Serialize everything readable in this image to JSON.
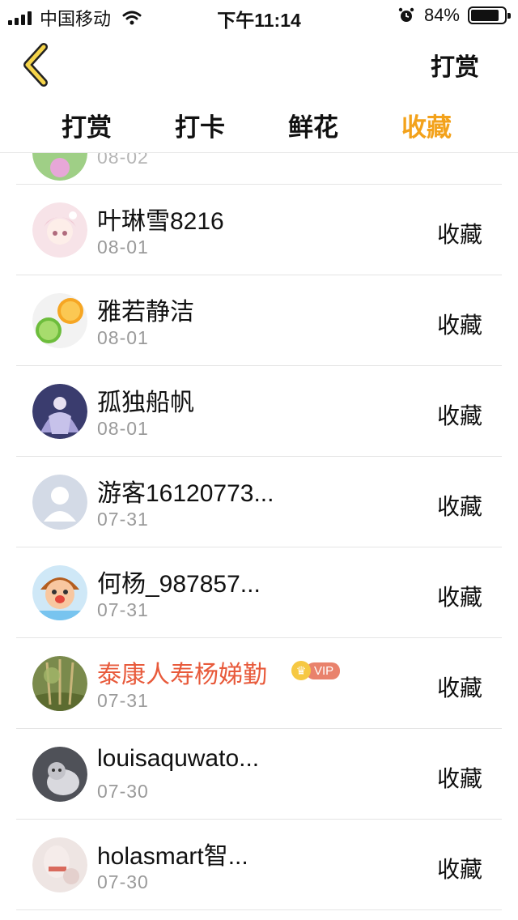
{
  "status_bar": {
    "carrier": "中国移动",
    "time": "下午11:14",
    "battery": "84%",
    "battery_level": 0.84
  },
  "nav": {
    "back_icon": "chevron-left-icon",
    "right_action": "打赏"
  },
  "tabs": [
    {
      "label": "打赏",
      "active": false
    },
    {
      "label": "打卡",
      "active": false
    },
    {
      "label": "鲜花",
      "active": false
    },
    {
      "label": "收藏",
      "active": true
    }
  ],
  "colors": {
    "accent": "#f3a21b",
    "vip_name": "#e85a3b"
  },
  "list": {
    "partial_date": "08-02",
    "items": [
      {
        "name": "叶琳雪8216",
        "date": "08-01",
        "action": "收藏"
      },
      {
        "name": "雅若静洁",
        "date": "08-01",
        "action": "收藏"
      },
      {
        "name": "孤独船帆",
        "date": "08-01",
        "action": "收藏"
      },
      {
        "name": "游客16120773...",
        "date": "07-31",
        "action": "收藏"
      },
      {
        "name": "何杨_987857...",
        "date": "07-31",
        "action": "收藏"
      },
      {
        "name": "泰康人寿杨娣勤",
        "date": "07-31",
        "action": "收藏",
        "vip": "VIP"
      },
      {
        "name": "louisaquwato...",
        "date": "07-30",
        "action": "收藏"
      },
      {
        "name": "holasmart智...",
        "date": "07-30",
        "action": "收藏"
      }
    ]
  }
}
